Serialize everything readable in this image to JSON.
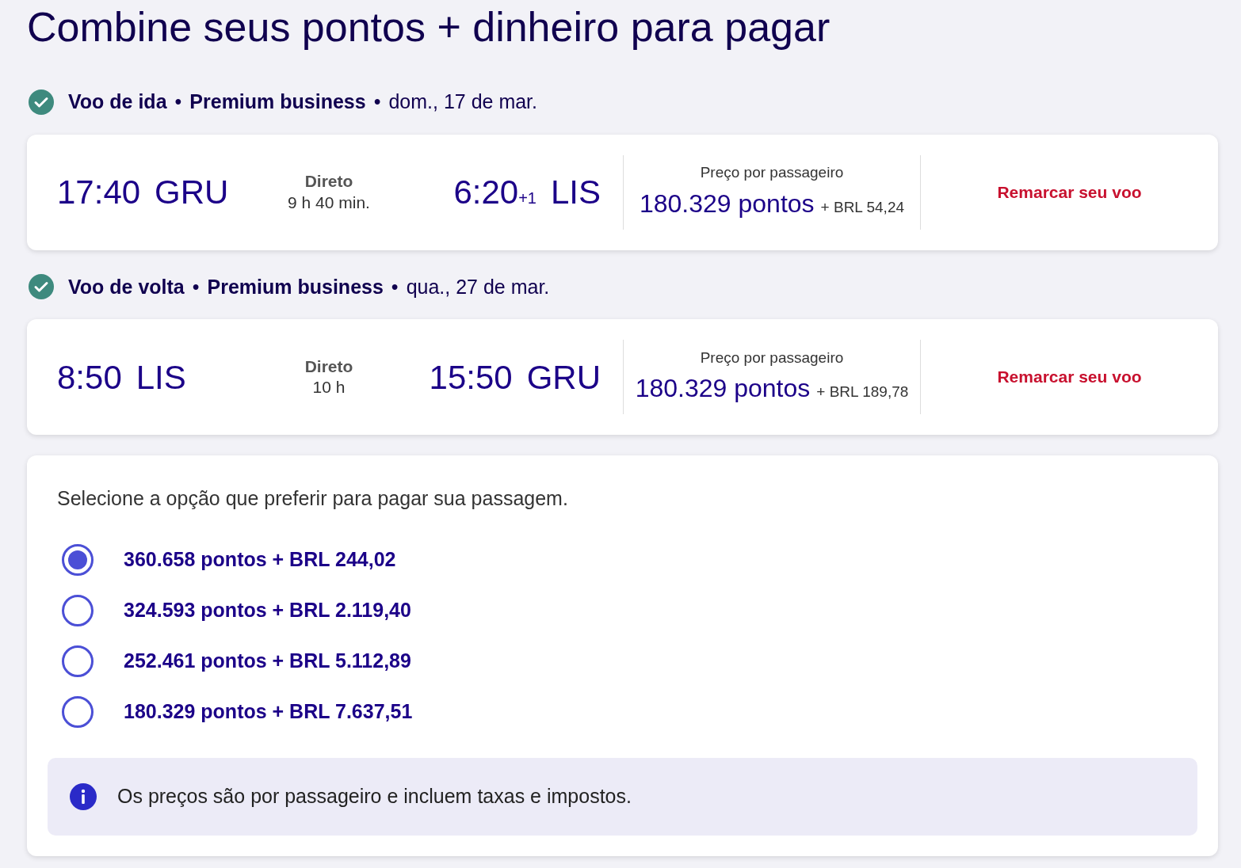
{
  "title": "Combine seus pontos + dinheiro para pagar",
  "flights": [
    {
      "checked": true,
      "direction": "Voo de ida",
      "sep_1": "•",
      "cabin": "Premium business",
      "sep_2": "•",
      "date": "dom., 17 de mar.",
      "departure_time": "17:40",
      "departure_airport": "GRU",
      "stops": "Direto",
      "duration": "9 h 40 min.",
      "arrival_time": "6:20",
      "day_offset": "+1",
      "arrival_airport": "LIS",
      "price_label": "Preço por passageiro",
      "points": "180.329 pontos",
      "cash": "+ BRL 54,24",
      "action": "Remarcar seu voo"
    },
    {
      "checked": true,
      "direction": "Voo de volta",
      "sep_1": "•",
      "cabin": "Premium business",
      "sep_2": "•",
      "date": "qua., 27 de mar.",
      "departure_time": "8:50",
      "departure_airport": "LIS",
      "stops": "Direto",
      "duration": "10 h",
      "arrival_time": "15:50",
      "arrival_airport": "GRU",
      "price_label": "Preço por passageiro",
      "points": "180.329 pontos",
      "cash": "+ BRL 189,78",
      "action": "Remarcar seu voo"
    }
  ],
  "payment": {
    "prompt": "Selecione a opção que preferir para pagar sua passagem.",
    "options": [
      {
        "label": "360.658 pontos + BRL 244,02",
        "selected": true
      },
      {
        "label": "324.593 pontos + BRL 2.119,40",
        "selected": false
      },
      {
        "label": "252.461 pontos + BRL 5.112,89",
        "selected": false
      },
      {
        "label": "180.329 pontos + BRL 7.637,51",
        "selected": false
      }
    ],
    "info": "Os preços são por passageiro e incluem taxas e impostos."
  }
}
